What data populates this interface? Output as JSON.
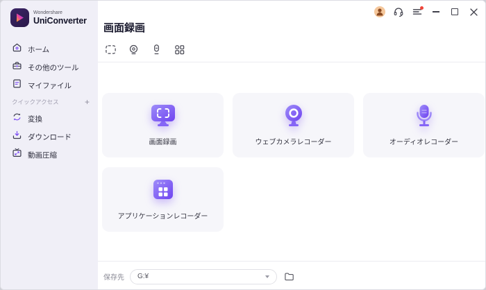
{
  "brand": {
    "line1": "Wondershare",
    "line2": "UniConverter"
  },
  "titlebar": {
    "icons": [
      "avatar",
      "headset-icon",
      "menu-notification-icon",
      "minimize-icon",
      "maximize-icon",
      "close-icon"
    ]
  },
  "sidebar": {
    "items": [
      {
        "label": "ホーム",
        "icon": "home-icon"
      },
      {
        "label": "その他のツール",
        "icon": "toolbox-icon"
      },
      {
        "label": "マイファイル",
        "icon": "file-icon"
      }
    ],
    "quick_access": {
      "label": "クイックアクセス",
      "add": "+"
    },
    "quick_items": [
      {
        "label": "変換",
        "icon": "convert-icon"
      },
      {
        "label": "ダウンロード",
        "icon": "download-icon"
      },
      {
        "label": "動画圧縮",
        "icon": "compress-icon"
      }
    ]
  },
  "main": {
    "title": "画面録画",
    "toolbar_icons": [
      "screen-region-icon",
      "webcam-icon",
      "mic-icon",
      "apps-grid-icon"
    ],
    "cards": [
      {
        "label": "画面録画",
        "icon": "screen-recorder-icon"
      },
      {
        "label": "ウェブカメラレコーダー",
        "icon": "webcam-recorder-icon"
      },
      {
        "label": "オーディオレコーダー",
        "icon": "audio-recorder-icon"
      },
      {
        "label": "アプリケーションレコーダー",
        "icon": "application-recorder-icon"
      }
    ],
    "footer": {
      "save_label": "保存先",
      "path_value": "G:¥",
      "folder_icon": "folder-icon"
    }
  },
  "colors": {
    "accent": "#7c4df3",
    "icon_gradient_start": "#9e8df9",
    "icon_gradient_end": "#6f43f0",
    "sidebar_bg": "#f0eff7",
    "card_bg": "#f6f6fa",
    "notification_dot": "#f0453a",
    "avatar_bg": "#f5c79b"
  }
}
